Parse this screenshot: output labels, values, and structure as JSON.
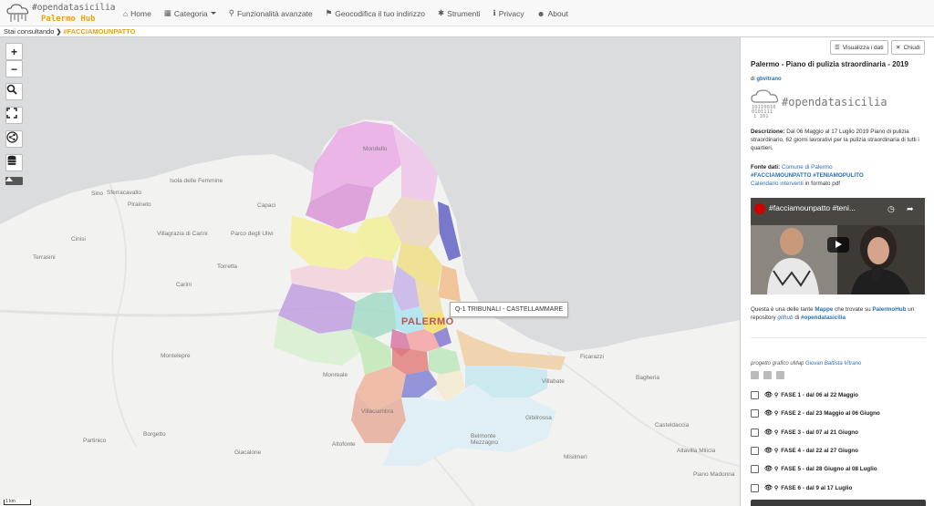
{
  "brand": {
    "line1": "#opendatasicilia",
    "line2": "Palermo Hub"
  },
  "nav": {
    "items": [
      {
        "icon": "⌂",
        "label": "Home"
      },
      {
        "icon": "▦",
        "label": "Categoria"
      },
      {
        "icon": "⚲",
        "label": "Funzionalità avanzate"
      },
      {
        "icon": "⚑",
        "label": "Geocodifica il tuo indirizzo"
      },
      {
        "icon": "✱",
        "label": "Strumenti"
      },
      {
        "icon": "ℹ",
        "label": "Privacy"
      },
      {
        "icon": "☻",
        "label": "About"
      }
    ]
  },
  "breadcrumb": {
    "label": "Stai consultando",
    "current": "#FACCIAMOUNPATTO"
  },
  "map": {
    "tooltip": "Q-1 TRIBUNALI - CASTELLAMMARE",
    "scale": "1 km",
    "city": "PALERMO",
    "places": [
      "Sferracavallo",
      "Mondello",
      "Isola delle Femmine",
      "Capaci",
      "Villagrazia di Carini",
      "Parco degli Ulivi",
      "Carini",
      "Cinisi",
      "Terrasini",
      "Montelepre",
      "Monreale",
      "Ficarazzi",
      "Bagheria",
      "Villabate",
      "Belmonte Mezzagno",
      "Altofonte",
      "Misilmeri",
      "Partinico",
      "Borgetto",
      "Giacalone",
      "Villaciambra",
      "Gibilrossa",
      "Casteldaccia",
      "Altavilla Milicia",
      "Piano Madonna",
      "Torretta",
      "Piraineto",
      "Sino"
    ],
    "controls": {
      "zoom_in": "+",
      "zoom_out": "−"
    }
  },
  "panel": {
    "view_data_button": "Visualizza i dati",
    "close_button": "Chiudi",
    "title": "Palermo - Piano di pulizia straordinaria - 2019",
    "author_prefix": "di",
    "author": "gbvitrano",
    "logo_text": "#opendatasicilia",
    "description_label": "Descrizione:",
    "description": "Dal 06 Maggio al 17 Luglio 2019 Piano di pulizia straordinario, 62 giorni lavorativi per la pulizia straordinaria di tutti i quartieri.",
    "source_label": "Fonte dati:",
    "source": "Comune di Palermo",
    "tags": "#FACCIAMOUNPATTO #TENIAMOPULITO",
    "calendar_link": "Calendario interventi",
    "calendar_suffix": "in formato pdf",
    "video_title": "#facciamounpatto #teni...",
    "map_note_1": "Questa è una delle tante",
    "map_note_mappe": "Mappe",
    "map_note_2": "che trovate su",
    "map_note_hub": "PalermoHub",
    "map_note_3": "un repository",
    "map_note_github": "github",
    "map_note_4": "di",
    "map_note_tag": "#opendatasicilia",
    "credit_prefix": "progetto grafico uMap",
    "credit_author": "Giovan Battista Vitrano",
    "phases": [
      "FASE 1 - dal 06 al 22 Maggio",
      "FASE 2 - dal 23 Maggio al 06 Giugno",
      "FASE 3 - dal 07 al 21 Giugno",
      "FASE 4 - dal 22 al 27 Giugno",
      "FASE 5 - dal 28 Giugno al 08 Luglio",
      "FASE 6 - dal 9 al 17 Luglio"
    ]
  },
  "colors": {
    "accent": "#e8a317",
    "link": "#2a6fb0"
  }
}
